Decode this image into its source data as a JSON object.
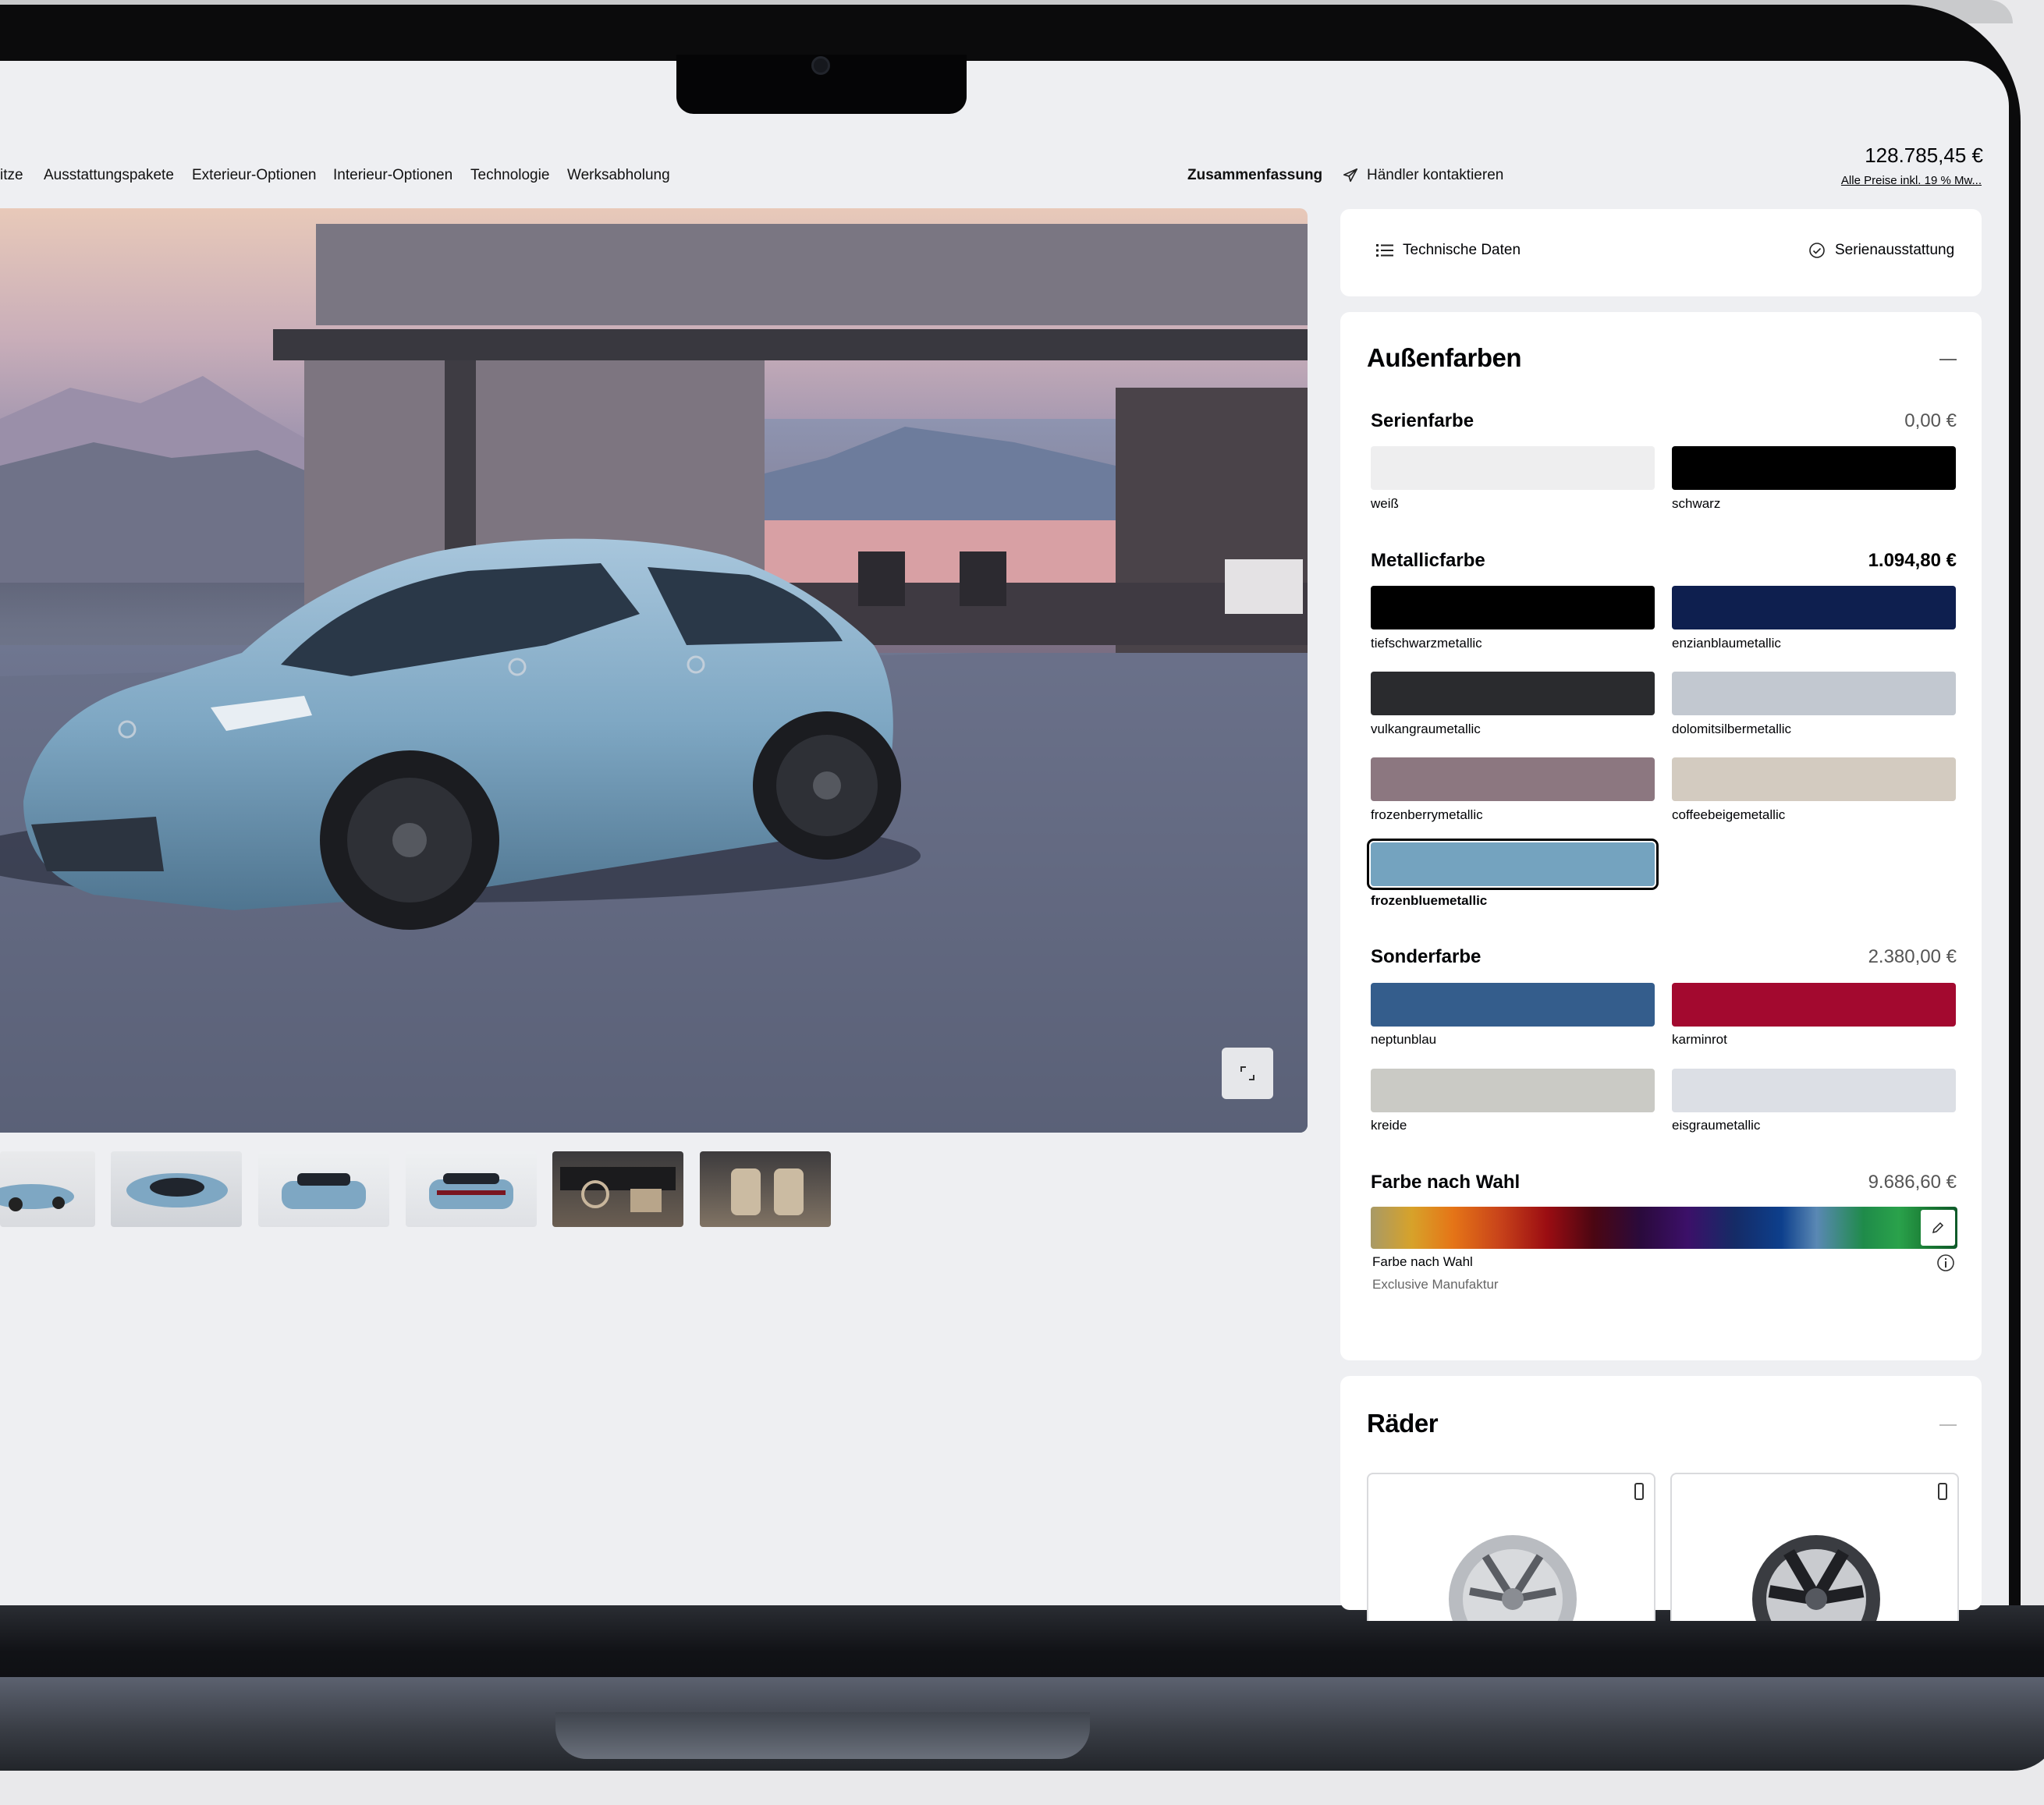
{
  "nav": {
    "items": [
      "itze",
      "Ausstattungspakete",
      "Exterieur-Optionen",
      "Interieur-Optionen",
      "Technologie",
      "Werksabholung"
    ],
    "summary": "Zusammenfassung",
    "contact": "Händler kontaktieren",
    "price_total": "128.785,45 €",
    "price_note": "Alle Preise inkl. 19 % Mw..."
  },
  "links": {
    "tech": "Technische Daten",
    "standard": "Serienausstattung"
  },
  "exterior": {
    "title": "Außenfarben",
    "groups": [
      {
        "name": "Serienfarbe",
        "price": "0,00 €",
        "colors": [
          {
            "label": "weiß",
            "hex": "#eeeeef"
          },
          {
            "label": "schwarz",
            "hex": "#000000"
          }
        ]
      },
      {
        "name": "Metallicfarbe",
        "price": "1.094,80 €",
        "colors": [
          {
            "label": "tiefschwarzmetallic",
            "hex": "#000000"
          },
          {
            "label": "enzianblaumetallic",
            "hex": "#0e1f4f"
          },
          {
            "label": "vulkangraumetallic",
            "hex": "#2a2b2e"
          },
          {
            "label": "dolomitsilbermetallic",
            "hex": "#c2c8d0"
          },
          {
            "label": "frozenberrymetallic",
            "hex": "#8c7780"
          },
          {
            "label": "coffeebeigemetallic",
            "hex": "#d3cbc0"
          },
          {
            "label": "frozenbluemetallic",
            "hex": "#74a3bf",
            "selected": true
          }
        ]
      },
      {
        "name": "Sonderfarbe",
        "price": "2.380,00 €",
        "colors": [
          {
            "label": "neptunblau",
            "hex": "#345d8c"
          },
          {
            "label": "karminrot",
            "hex": "#a3092f"
          },
          {
            "label": "kreide",
            "hex": "#cacac5"
          },
          {
            "label": "eisgraumetallic",
            "hex": "#dcdfe5"
          }
        ]
      }
    ],
    "custom": {
      "name": "Farbe nach Wahl",
      "price": "9.686,60 €",
      "label": "Farbe nach Wahl",
      "sub": "Exclusive Manufaktur"
    }
  },
  "wheels": {
    "title": "Räder"
  },
  "colors": {
    "accent": "#74a3bf",
    "text": "#010205",
    "panel": "#ffffff",
    "page": "#eeeff2"
  },
  "icons": [
    "list-icon",
    "check-circle-icon",
    "send-icon",
    "expand-icon",
    "pencil-icon",
    "info-icon",
    "minus-icon",
    "compare-icon"
  ]
}
